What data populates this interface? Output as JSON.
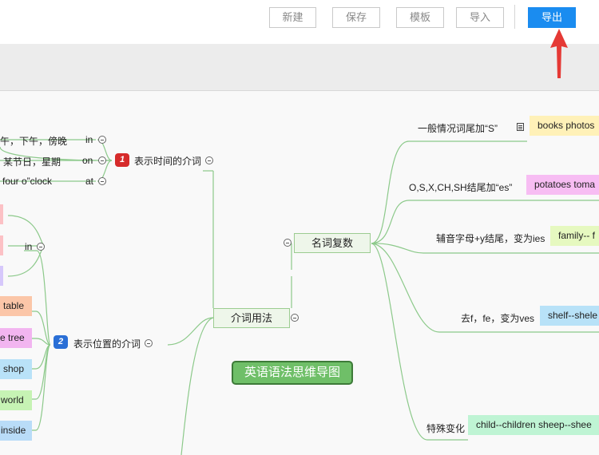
{
  "toolbar": {
    "new_label": "新建",
    "save_label": "保存",
    "template_label": "模板",
    "import_label": "导入",
    "export_label": "导出"
  },
  "colors": {
    "accent": "#1a8cf0",
    "arrow": "#e53935",
    "line": "#8cc98a",
    "root_fill": "#6fbf68"
  },
  "mindmap": {
    "root": "英语语法思维导图",
    "left_main": "介词用法",
    "right_main": "名词复数",
    "time_branch": {
      "badge": "1",
      "label": "表示时间的介词",
      "items": [
        {
          "text": "午，下午，傍晚",
          "prep": "in"
        },
        {
          "text": "某节日，星期",
          "prep": "on"
        },
        {
          "text": "four o”clock",
          "prep": "at"
        }
      ]
    },
    "place_branch": {
      "badge": "2",
      "label": "表示位置的介词",
      "in_label": "in",
      "items": [
        {
          "text": "table",
          "color": "#fbc6a8"
        },
        {
          "text": "e tree",
          "color": "#f2b5f0"
        },
        {
          "text": "shop",
          "color": "#b9e2f8"
        },
        {
          "text": "world",
          "color": "#c6f3b4"
        },
        {
          "text": "inside",
          "color": "#b9dcf8"
        }
      ],
      "partial_colors": [
        "#fcc1c5",
        "#fcc1c5",
        "#d6c8fb"
      ]
    },
    "plural_rules": [
      {
        "label": "一般情况词尾加“S”",
        "example": "books photos",
        "color": "#fff1b8"
      },
      {
        "label": "O,S,X,CH,SH结尾加“es”",
        "example": "potatoes toma",
        "color": "#f7bdf3"
      },
      {
        "label": "辅音字母+y结尾，变为ies",
        "example": "family-- f",
        "color": "#e6f9c0"
      },
      {
        "label": "去f，fe，变为ves",
        "example": "shelf--shele",
        "color": "#b8e2f8"
      },
      {
        "label": "特殊变化",
        "example": "child--children sheep--shee",
        "color": "#bff4d4"
      }
    ]
  }
}
